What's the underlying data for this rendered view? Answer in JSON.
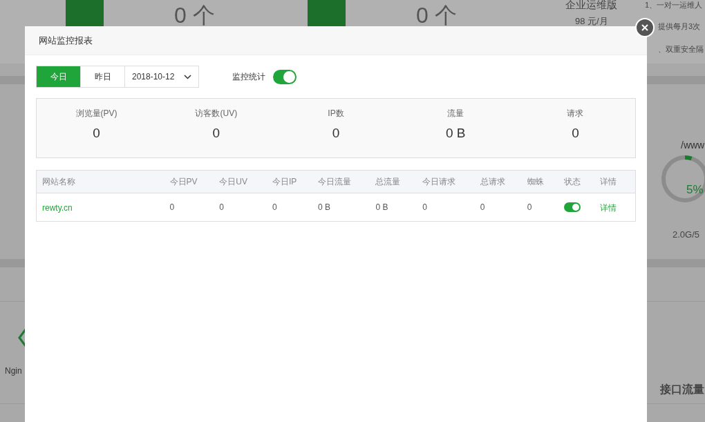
{
  "background": {
    "cards": [
      {
        "count": "0 个"
      },
      {
        "count": "0 个"
      }
    ],
    "plan": {
      "name": "企业运维版",
      "price": "98 元/月"
    },
    "plan_features": [
      "1、一对一运维人",
      "提供每月3次",
      "、双重安全隔"
    ],
    "disk": {
      "path": "/www",
      "percent": "5%",
      "level": 0.05,
      "usage": "2.0G/5"
    },
    "software": {
      "name": "Ngin"
    },
    "traffic_title": "接口流量"
  },
  "modal": {
    "title": "网站监控报表",
    "tabs": [
      {
        "label": "今日",
        "selected": true
      },
      {
        "label": "昨日",
        "selected": false
      }
    ],
    "date": "2018-10-12",
    "monitor": {
      "label": "监控统计",
      "on": true
    },
    "stats": [
      {
        "label": "浏览量(PV)",
        "value": "0"
      },
      {
        "label": "访客数(UV)",
        "value": "0"
      },
      {
        "label": "IP数",
        "value": "0"
      },
      {
        "label": "流量",
        "value": "0 B"
      },
      {
        "label": "请求",
        "value": "0"
      }
    ],
    "table": {
      "columns": [
        "网站名称",
        "今日PV",
        "今日UV",
        "今日IP",
        "今日流量",
        "总流量",
        "今日请求",
        "总请求",
        "蜘蛛",
        "状态",
        "详情"
      ],
      "rows": [
        {
          "cells": [
            "rewty.cn",
            "0",
            "0",
            "0",
            "0 B",
            "0 B",
            "0",
            "0",
            "0"
          ],
          "on": true,
          "detail": "详情"
        }
      ]
    }
  }
}
